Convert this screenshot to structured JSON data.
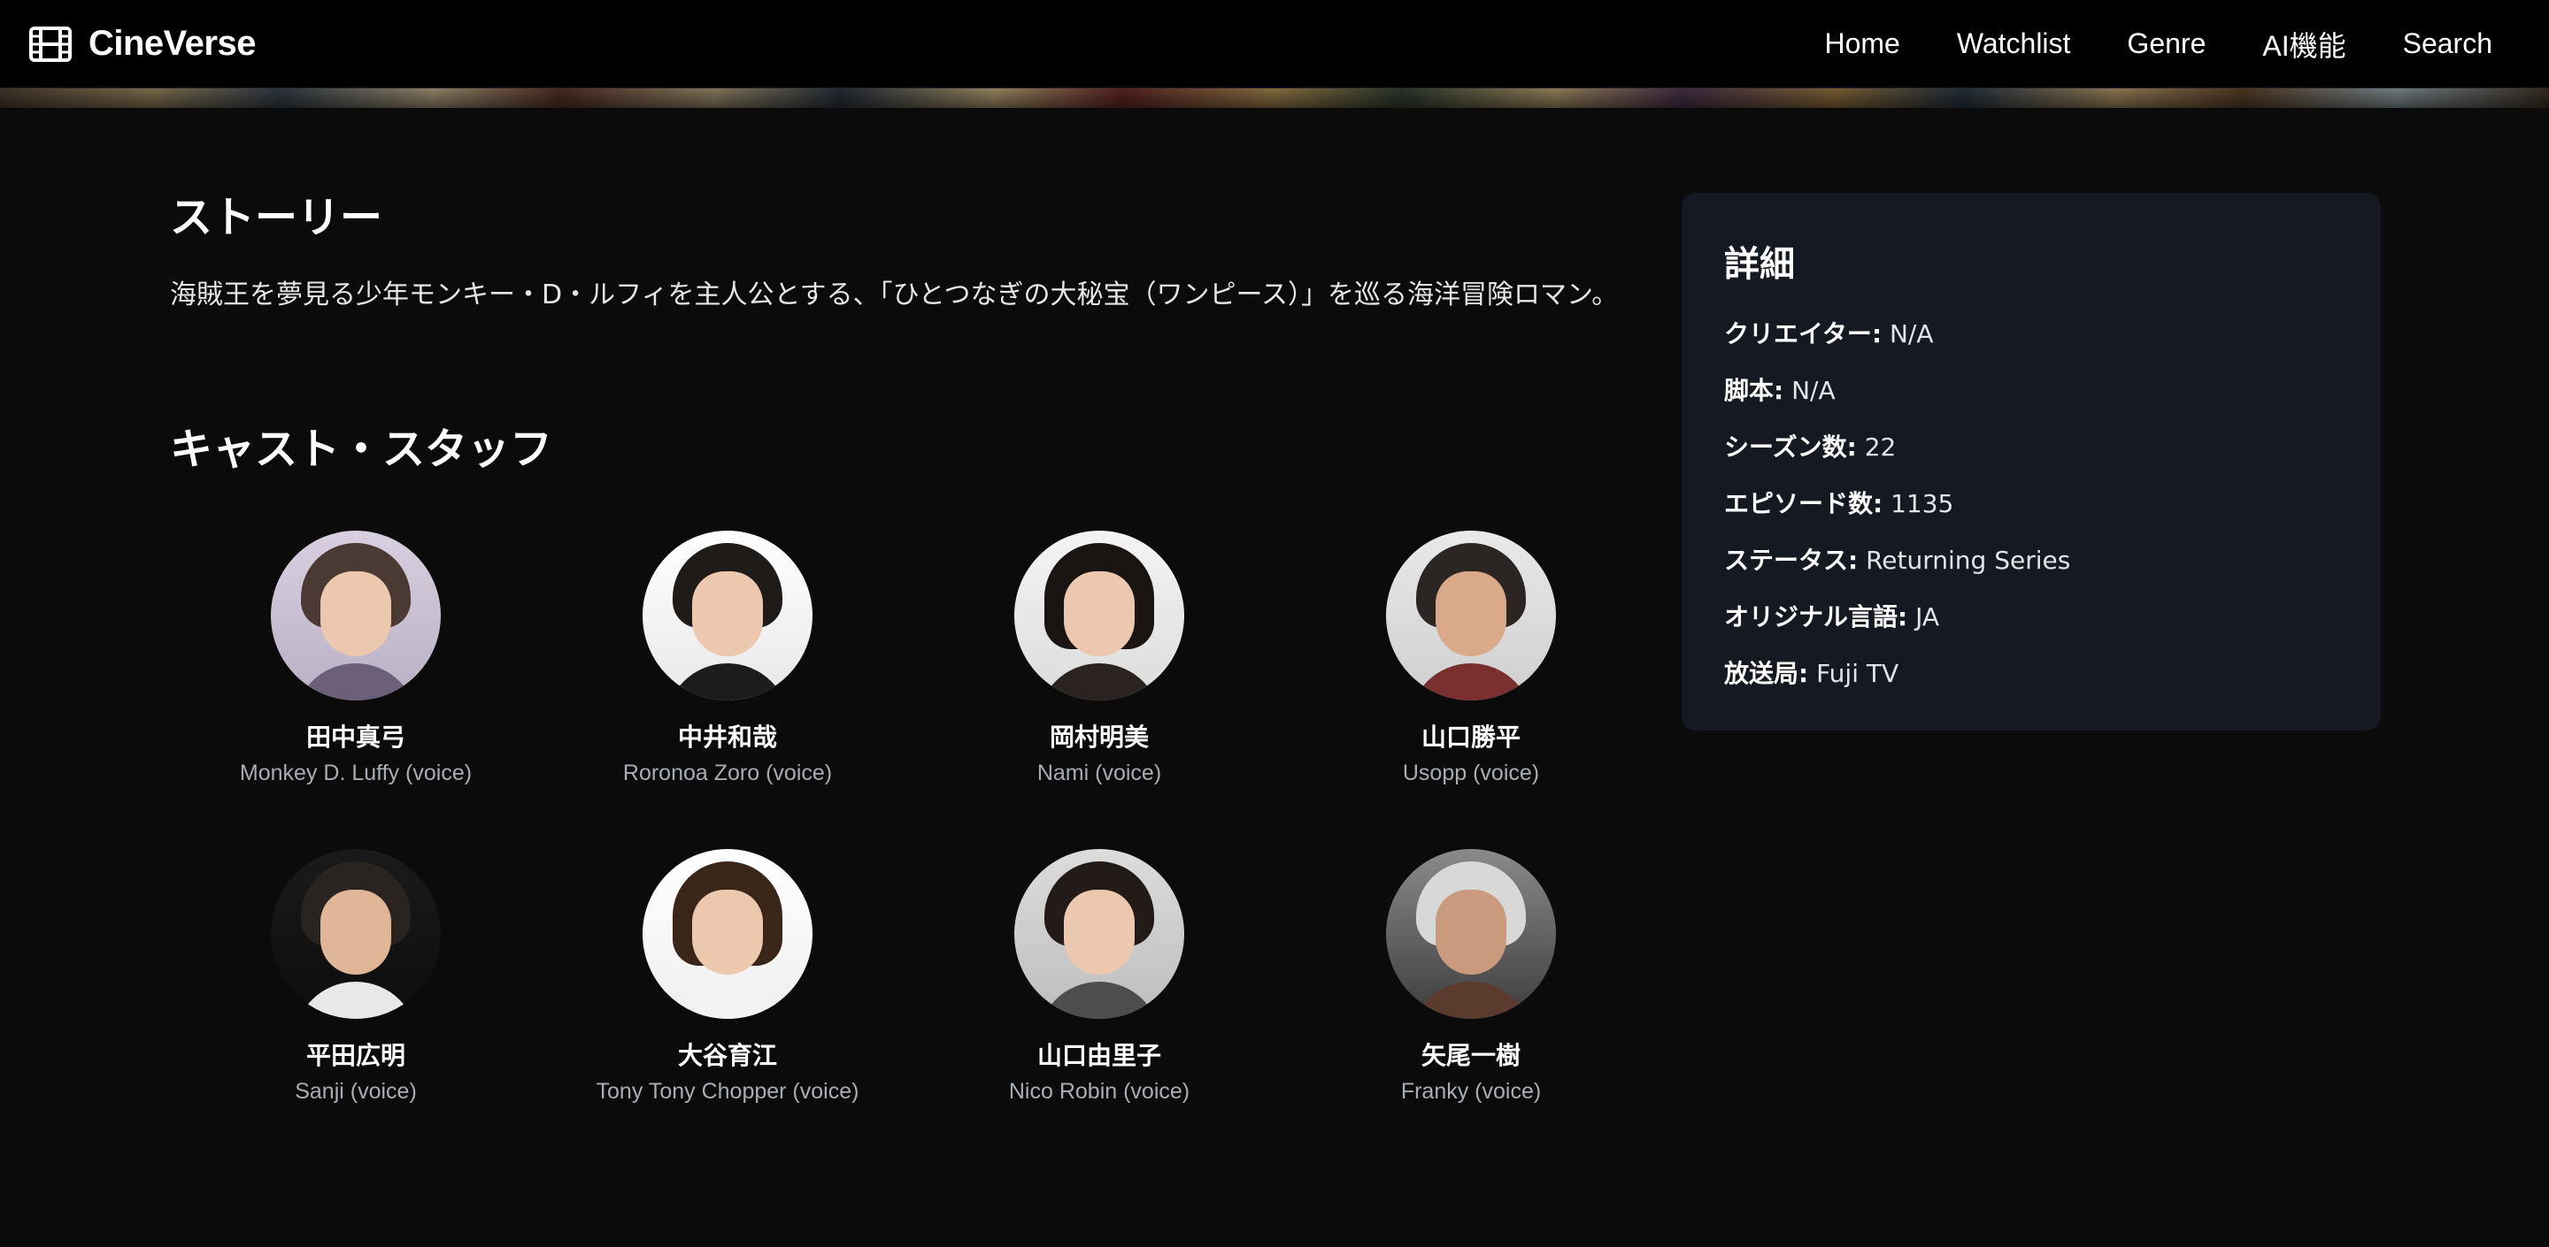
{
  "brand": {
    "name": "CineVerse",
    "icon": "film-icon"
  },
  "nav": {
    "items": [
      "Home",
      "Watchlist",
      "Genre",
      "AI機能",
      "Search"
    ]
  },
  "story": {
    "title": "ストーリー",
    "text": "海賊王を夢見る少年モンキー・D・ルフィを主人公とする、「ひとつなぎの大秘宝（ワンピース）」を巡る海洋冒険ロマン。"
  },
  "cast": {
    "title": "キャスト・スタッフ",
    "members": [
      {
        "name": "田中真弓",
        "role": "Monkey D. Luffy (voice)"
      },
      {
        "name": "中井和哉",
        "role": "Roronoa Zoro (voice)"
      },
      {
        "name": "岡村明美",
        "role": "Nami (voice)"
      },
      {
        "name": "山口勝平",
        "role": "Usopp (voice)"
      },
      {
        "name": "平田広明",
        "role": "Sanji (voice)"
      },
      {
        "name": "大谷育江",
        "role": "Tony Tony Chopper (voice)"
      },
      {
        "name": "山口由里子",
        "role": "Nico Robin (voice)"
      },
      {
        "name": "矢尾一樹",
        "role": "Franky (voice)"
      }
    ]
  },
  "details": {
    "title": "詳細",
    "rows": [
      {
        "label": "クリエイター:",
        "value": "N/A"
      },
      {
        "label": "脚本:",
        "value": "N/A"
      },
      {
        "label": "シーズン数:",
        "value": "22"
      },
      {
        "label": "エピソード数:",
        "value": "1135"
      },
      {
        "label": "ステータス:",
        "value": "Returning Series"
      },
      {
        "label": "オリジナル言語:",
        "value": "JA"
      },
      {
        "label": "放送局:",
        "value": "Fuji TV"
      }
    ]
  },
  "colors": {
    "background": "#0b0b0b",
    "navbar": "#000000",
    "panel": "#151a22",
    "muted_text": "#a8adb5"
  }
}
